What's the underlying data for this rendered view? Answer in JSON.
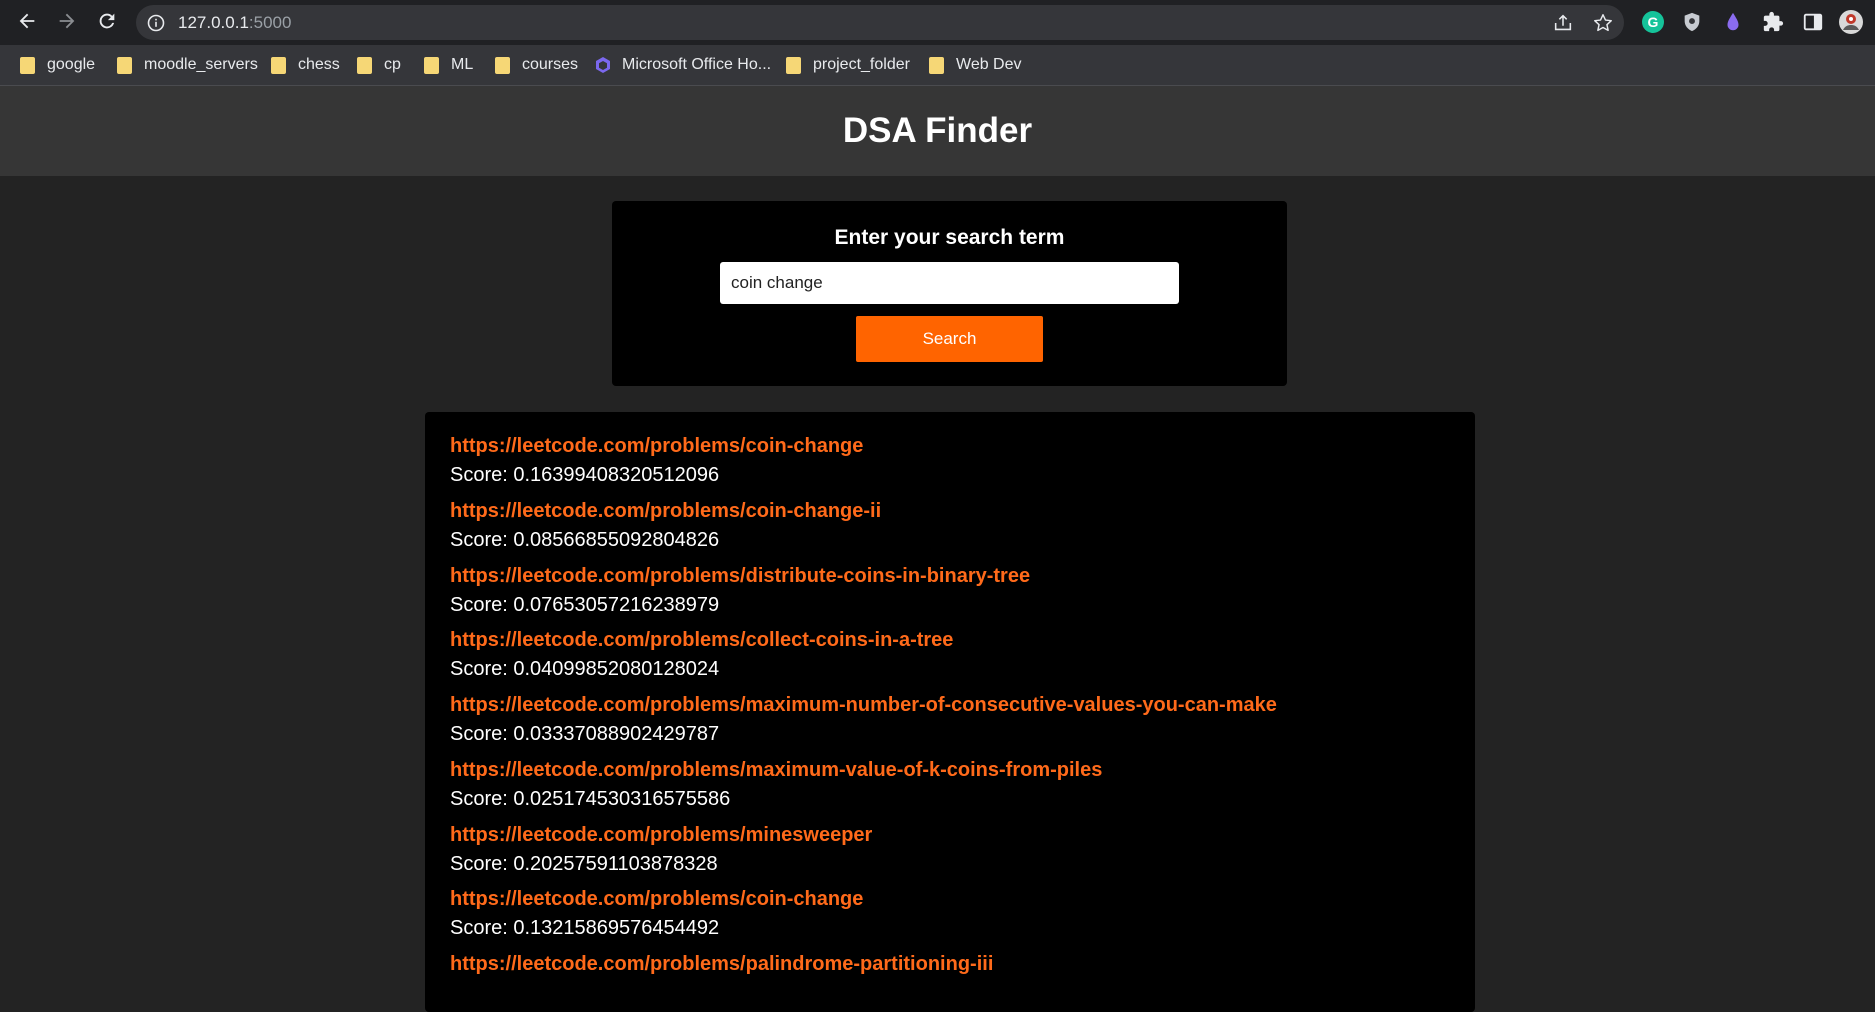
{
  "browser": {
    "url_host": "127.0.0.1",
    "url_port": ":5000",
    "bookmarks": [
      {
        "label": "google",
        "icon": "folder-icon"
      },
      {
        "label": "moodle_servers",
        "icon": "folder-icon"
      },
      {
        "label": "chess",
        "icon": "folder-icon"
      },
      {
        "label": "cp",
        "icon": "folder-icon"
      },
      {
        "label": "ML",
        "icon": "folder-icon"
      },
      {
        "label": "courses",
        "icon": "folder-icon"
      },
      {
        "label": "Microsoft Office Ho...",
        "icon": "office-icon"
      },
      {
        "label": "project_folder",
        "icon": "folder-icon"
      },
      {
        "label": "Web Dev",
        "icon": "folder-icon"
      }
    ]
  },
  "header": {
    "title": "DSA Finder"
  },
  "search": {
    "label": "Enter your search term",
    "value": "coin change",
    "button_label": "Search"
  },
  "results": [
    {
      "url": "https://leetcode.com/problems/coin-change",
      "score": "Score: 0.16399408320512096"
    },
    {
      "url": "https://leetcode.com/problems/coin-change-ii",
      "score": "Score: 0.08566855092804826"
    },
    {
      "url": "https://leetcode.com/problems/distribute-coins-in-binary-tree",
      "score": "Score: 0.07653057216238979"
    },
    {
      "url": "https://leetcode.com/problems/collect-coins-in-a-tree",
      "score": "Score: 0.04099852080128024"
    },
    {
      "url": "https://leetcode.com/problems/maximum-number-of-consecutive-values-you-can-make",
      "score": "Score: 0.03337088902429787"
    },
    {
      "url": "https://leetcode.com/problems/maximum-value-of-k-coins-from-piles",
      "score": "Score: 0.025174530316575586"
    },
    {
      "url": "https://leetcode.com/problems/minesweeper",
      "score": "Score: 0.20257591103878328"
    },
    {
      "url": "https://leetcode.com/problems/coin-change",
      "score": "Score: 0.13215869576454492"
    },
    {
      "url": "https://leetcode.com/problems/palindrome-partitioning-iii",
      "score": ""
    }
  ],
  "colors": {
    "accent": "#ff6400",
    "link": "#ff6a1a",
    "page_bg": "#232323",
    "header_bg": "#363636",
    "panel_bg": "#000000"
  }
}
